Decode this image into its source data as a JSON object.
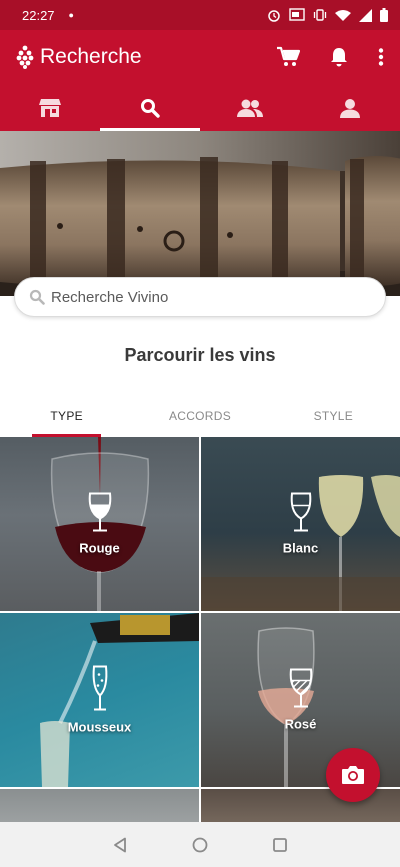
{
  "status_bar": {
    "time": "22:27",
    "icons": [
      "notification-dot-icon",
      "alarm-icon",
      "cast-icon",
      "vibrate-icon",
      "wifi-icon",
      "signal-icon",
      "battery-icon"
    ]
  },
  "app_bar": {
    "title": "Recherche",
    "icons": [
      "grape-logo-icon",
      "cart-icon",
      "bell-icon",
      "more-vert-icon"
    ]
  },
  "tabs": [
    {
      "name": "shop",
      "icon": "store-icon",
      "active": false
    },
    {
      "name": "search",
      "icon": "search-icon",
      "active": true
    },
    {
      "name": "friends",
      "icon": "friends-icon",
      "active": false
    },
    {
      "name": "profile",
      "icon": "person-icon",
      "active": false
    }
  ],
  "search": {
    "placeholder": "Recherche Vivino"
  },
  "browse": {
    "title": "Parcourir les vins",
    "tabs": [
      {
        "label": "TYPE",
        "active": true
      },
      {
        "label": "ACCORDS",
        "active": false
      },
      {
        "label": "STYLE",
        "active": false
      }
    ],
    "wine_types": [
      {
        "label": "Rouge",
        "icon": "red-wine-glass-icon"
      },
      {
        "label": "Blanc",
        "icon": "white-wine-glass-icon"
      },
      {
        "label": "Mousseux",
        "icon": "sparkling-glass-icon"
      },
      {
        "label": "Rosé",
        "icon": "rose-wine-glass-icon"
      }
    ]
  },
  "fab": {
    "icon": "camera-icon"
  },
  "nav_bar": {
    "icons": [
      "back-icon",
      "home-icon",
      "recents-icon"
    ]
  },
  "colors": {
    "brand": "#c3102e",
    "status_bar": "#a80f28"
  }
}
